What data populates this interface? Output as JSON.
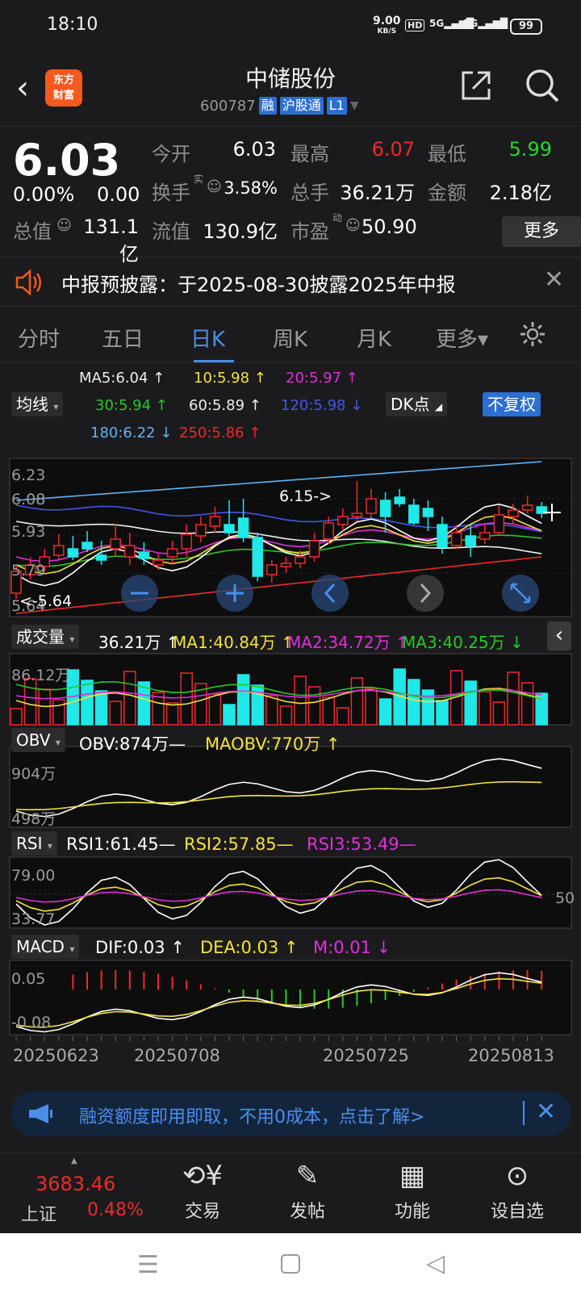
{
  "status": {
    "time": "18:10",
    "speed": "9.00",
    "speed_unit": "KB/S",
    "hd": "HD",
    "sig1": "5G",
    "sig2": "5G",
    "battery": "99"
  },
  "header": {
    "name": "中储股份",
    "code": "600787",
    "tags": [
      "融",
      "沪股通",
      "L1"
    ],
    "logo": "东方财富"
  },
  "quote": {
    "price": "6.03",
    "change_pct": "0.00%",
    "change": "0.00",
    "open_label": "今开",
    "open": "6.03",
    "high_label": "最高",
    "high": "6.07",
    "low_label": "最低",
    "low": "5.99",
    "turnover_label": "换手",
    "turnover": "3.58%",
    "volume_label": "总手",
    "volume": "36.21万",
    "amount_label": "金额",
    "amount": "2.18亿",
    "mktcap_label": "总值",
    "mktcap": "131.1亿",
    "float_label": "流值",
    "float": "130.9亿",
    "pe_label": "市盈",
    "pe": "50.90",
    "more": "更多",
    "real": "实",
    "dyn": "动"
  },
  "notice": {
    "text": "中报预披露：于2025-08-30披露2025年中报"
  },
  "tabs": [
    "分时",
    "五日",
    "日K",
    "周K",
    "月K",
    "更多▾"
  ],
  "ma": {
    "ma5": "MA5:6.04 ↑",
    "ma10": "10:5.98 ↑",
    "ma20": "20:5.97 ↑",
    "ma30": "30:5.94 ↑",
    "ma60": "60:5.89 ↑",
    "ma120": "120:5.98 ↓",
    "ma180": "180:6.22 ↓",
    "ma250": "250:5.86 ↑",
    "sel": "均线",
    "dk": "DK点",
    "fq": "不复权"
  },
  "kline": {
    "y_labels": [
      "6.23",
      "6.08",
      "5.93",
      "5.79",
      "5.64"
    ],
    "max_note": "6.15->",
    "min_note": "<-5.64"
  },
  "vol": {
    "sel": "成交量",
    "v": "36.21万 ↑",
    "ma1": "MA1:40.84万 ↑",
    "ma2": "MA2:34.72万 ↑",
    "ma3": "MA3:40.25万 ↓",
    "ylab": "86.12万"
  },
  "obv": {
    "sel": "OBV",
    "v": "OBV:874万—",
    "ma": "MAOBV:770万 ↑",
    "y1": "904万",
    "y2": "498万"
  },
  "rsi": {
    "sel": "RSI",
    "r1": "RSI1:61.45—",
    "r2": "RSI2:57.85—",
    "r3": "RSI3:53.49—",
    "y1": "79.00",
    "y2": "33.77",
    "y3": "50"
  },
  "macd": {
    "sel": "MACD",
    "dif": "DIF:0.03 ↑",
    "dea": "DEA:0.03 ↑",
    "m": "M:0.01 ↓",
    "y1": "0.05",
    "y2": "-0.08"
  },
  "dates": [
    "20250623",
    "20250708",
    "20250725",
    "20250813"
  ],
  "promo": {
    "text": "融资额度即用即取，不用0成本，点击了解>"
  },
  "bottom": {
    "index_value": "3683.46",
    "index_name": "上证",
    "index_pct": "0.48%",
    "items": [
      "交易",
      "发帖",
      "功能",
      "设自选"
    ]
  },
  "colors": {
    "accent": "#4a8eea",
    "up": "#ee2a2a",
    "down": "#1ee8e8"
  }
}
